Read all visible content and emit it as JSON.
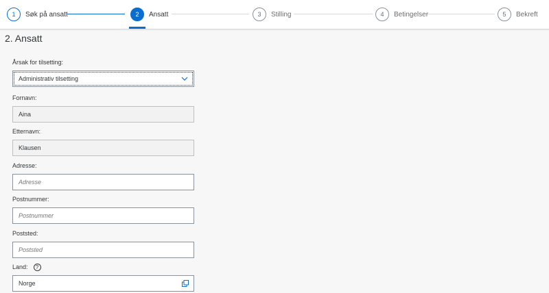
{
  "wizard": {
    "steps": [
      {
        "number": "1",
        "label": "Søk på ansatt",
        "state": "done"
      },
      {
        "number": "2",
        "label": "Ansatt",
        "state": "active"
      },
      {
        "number": "3",
        "label": "Stilling",
        "state": "pending"
      },
      {
        "number": "4",
        "label": "Betingelser",
        "state": "pending"
      },
      {
        "number": "5",
        "label": "Bekreft",
        "state": "pending"
      }
    ],
    "accent_color": "#0a6ed1"
  },
  "section": {
    "title": "2. Ansatt"
  },
  "form": {
    "reason": {
      "label": "Årsak for tilsetting:",
      "value": "Administrativ tilsetting",
      "icon": "chevron-down-icon"
    },
    "first_name": {
      "label": "Fornavn:",
      "value": "Aina"
    },
    "last_name": {
      "label": "Etternavn:",
      "value": "Klausen"
    },
    "address": {
      "label": "Adresse:",
      "placeholder": "Adresse"
    },
    "postal_code": {
      "label": "Postnummer:",
      "placeholder": "Postnummer"
    },
    "city": {
      "label": "Poststed:",
      "placeholder": "Poststed"
    },
    "country": {
      "label": "Land:",
      "value": "Norge",
      "help_icon": "help-icon",
      "value_help_icon": "value-help-icon"
    }
  }
}
